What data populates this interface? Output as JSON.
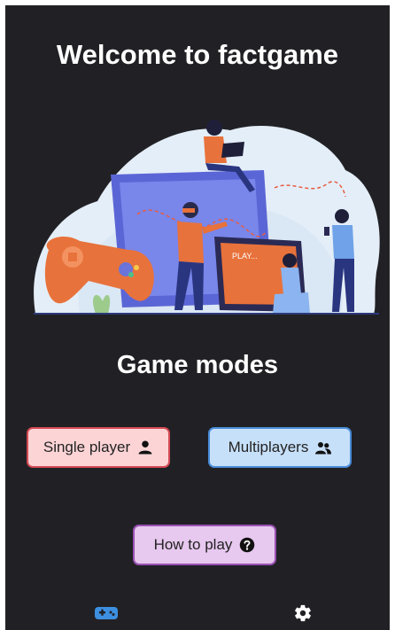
{
  "header": {
    "title": "Welcome to factgame"
  },
  "hero": {
    "illustration": "gamers-illustration",
    "screen_text": "PLAY..."
  },
  "game_modes": {
    "heading": "Game modes",
    "single_player": {
      "label": "Single player",
      "icon": "person-icon"
    },
    "multiplayers": {
      "label": "Multiplayers",
      "icon": "people-icon"
    },
    "how_to_play": {
      "label": "How to play",
      "icon": "question-circle-icon"
    }
  },
  "bottom_nav": {
    "items": [
      {
        "icon": "gamepad-icon",
        "active": true
      },
      {
        "icon": "gear-icon",
        "active": false
      }
    ]
  },
  "colors": {
    "background": "#212125",
    "single_player_bg": "#fdd4d6",
    "single_player_border": "#d44a55",
    "multiplayers_bg": "#c7e0fa",
    "multiplayers_border": "#4a8cd9",
    "how_to_play_bg": "#e7c8ee",
    "how_to_play_border": "#9a50b3",
    "active_tab": "#3d8fe0",
    "inactive_tab": "#ffffff"
  }
}
